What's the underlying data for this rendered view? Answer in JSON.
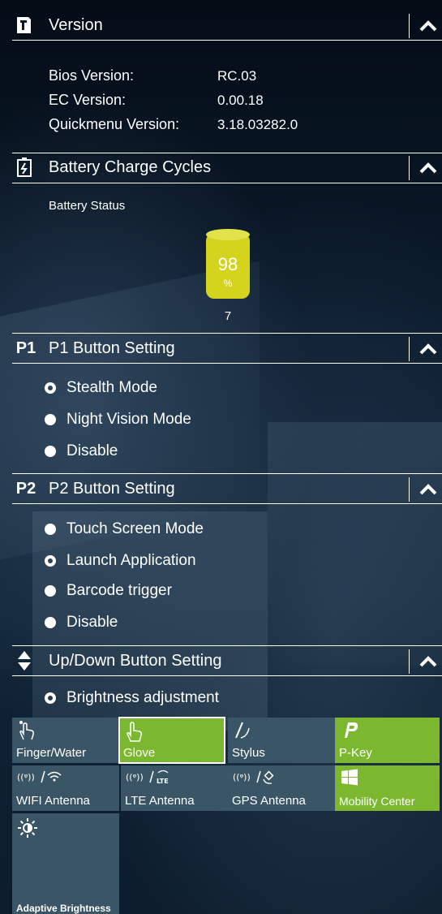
{
  "sections": {
    "version": {
      "title": "Version",
      "rows": [
        {
          "label": "Bios Version:",
          "value": "RC.03"
        },
        {
          "label": "EC Version:",
          "value": "0.00.18"
        },
        {
          "label": "Quickmenu Version:",
          "value": "3.18.03282.0"
        }
      ]
    },
    "battery": {
      "title": "Battery Charge Cycles",
      "status_label": "Battery Status",
      "percent_value": "98",
      "percent_sign": "%",
      "cycles": "7",
      "level_fraction": 0.98,
      "color": "#d4d41e"
    },
    "p1": {
      "badge": "P1",
      "title": "P1 Button Setting",
      "options": [
        "Stealth Mode",
        "Night Vision Mode",
        "Disable"
      ],
      "selected": "Stealth Mode"
    },
    "p2": {
      "badge": "P2",
      "title": "P2 Button Setting",
      "options": [
        "Touch Screen Mode",
        "Launch Application",
        "Barcode trigger",
        "Disable"
      ],
      "selected": "Launch Application"
    },
    "updown": {
      "title": "Up/Down Button Setting",
      "options": [
        "Brightness adjustment"
      ],
      "selected": "Brightness adjustment"
    }
  },
  "tiles": [
    {
      "label": "Finger/Water",
      "icon": "finger-water-icon",
      "active": false
    },
    {
      "label": "Glove",
      "icon": "glove-icon",
      "active": true
    },
    {
      "label": "Stylus",
      "icon": "stylus-icon",
      "active": false
    },
    {
      "label": "P-Key",
      "icon": "p-key-icon",
      "active": true
    },
    {
      "label": "WIFI Antenna",
      "icon": "wifi-antenna-icon",
      "active": false
    },
    {
      "label": "LTE Antenna",
      "icon": "lte-antenna-icon",
      "active": false
    },
    {
      "label": "GPS Antenna",
      "icon": "gps-antenna-icon",
      "active": false
    },
    {
      "label": "Mobility Center",
      "icon": "windows-icon",
      "active": true
    },
    {
      "label": "Adaptive Brightness",
      "icon": "sun-icon",
      "active": false
    }
  ],
  "colors": {
    "tile_inactive": "#3a5666",
    "tile_active": "#7cb82f",
    "battery": "#d4d41e"
  }
}
